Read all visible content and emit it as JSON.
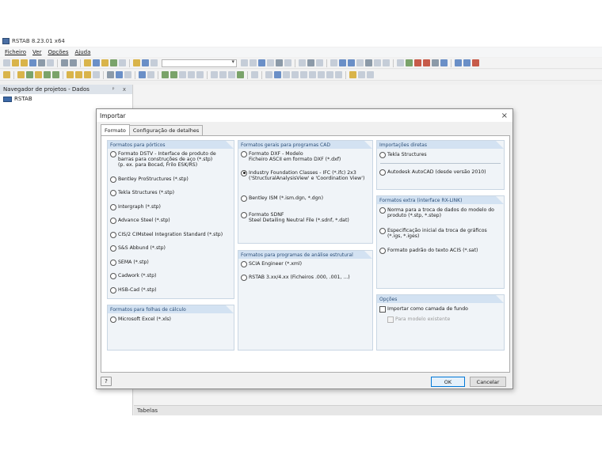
{
  "app": {
    "title": "RSTAB 8.23.01 x64",
    "menu": [
      "Ficheiro",
      "Ver",
      "Opções",
      "Ajuda"
    ]
  },
  "navigator": {
    "header": "Navegador de projetos - Dados",
    "controls": "ᵖ x",
    "root": "RSTAB"
  },
  "statusbar": {
    "tables_label": "Tabelas"
  },
  "dialog": {
    "title": "Importar",
    "close": "×",
    "tabs": [
      "Formato",
      "Configuração de detalhes"
    ],
    "group_porticos": {
      "title": "Formatos para pórticos",
      "options": [
        "Formato DSTV - Interface de produto de barras para construções de aço (*.stp)\n(p. ex. para Bocad, Frilo ESK/RS)",
        "Bentley ProStructures (*.stp)",
        "Tekla Structures (*.stp)",
        "Intergraph (*.stp)",
        "Advance Steel (*.stp)",
        "CIS/2 CIMsteel Integration Standard (*.stp)",
        "S&S Abbund (*.stp)",
        "SEMA (*.stp)",
        "Cadwork (*.stp)",
        "HSB-Cad (*.stp)"
      ]
    },
    "group_folhas": {
      "title": "Formatos para folhas de cálculo",
      "options": [
        "Microsoft Excel (*.xls)"
      ]
    },
    "group_cad": {
      "title": "Formatos gerais para programas CAD",
      "options": [
        "Formato DXF - Modelo\nFicheiro ASCII em formato DXF (*.dxf)",
        "Industry Foundation Classes - IFC (*.ifc) 2x3\n('StructuralAnalysisView' e 'Coordination View')",
        "Bentley ISM (*.ism.dgn, *.dgn)",
        "Formato SDNF\nSteel Detailing Neutral File (*.sdnf, *.dat)"
      ],
      "selected_index": 1
    },
    "group_analise": {
      "title": "Formatos para programas de análise estrutural",
      "options": [
        "SCIA Engineer (*.xml)",
        "RSTAB 3.xx/4.xx (Ficheiros .000, .001, ...)"
      ]
    },
    "group_diretas": {
      "title": "Importações diretas",
      "options": [
        "Tekla Structures",
        "Autodesk AutoCAD (desde versão 2010)"
      ]
    },
    "group_extra": {
      "title": "Formatos extra (interface RX-LINK)",
      "options": [
        "Norma para a troca de dados do modelo do produto (*.stp, *.step)",
        "Especificação inicial da troca de gráficos (*.igs, *.iges)",
        "Formato padrão do texto ACIS (*.sat)"
      ]
    },
    "group_opcoes": {
      "title": "Opções",
      "background_layer": "Importar como camada de fundo",
      "existing_model": "Para modelo existente"
    },
    "buttons": {
      "help": "?",
      "ok": "OK",
      "cancel": "Cancelar"
    }
  },
  "colors": {
    "group_header_bg": "#d3e2f2",
    "group_header_text": "#2c4f78",
    "group_bg": "#f0f4f8",
    "accent": "#0078d7"
  }
}
